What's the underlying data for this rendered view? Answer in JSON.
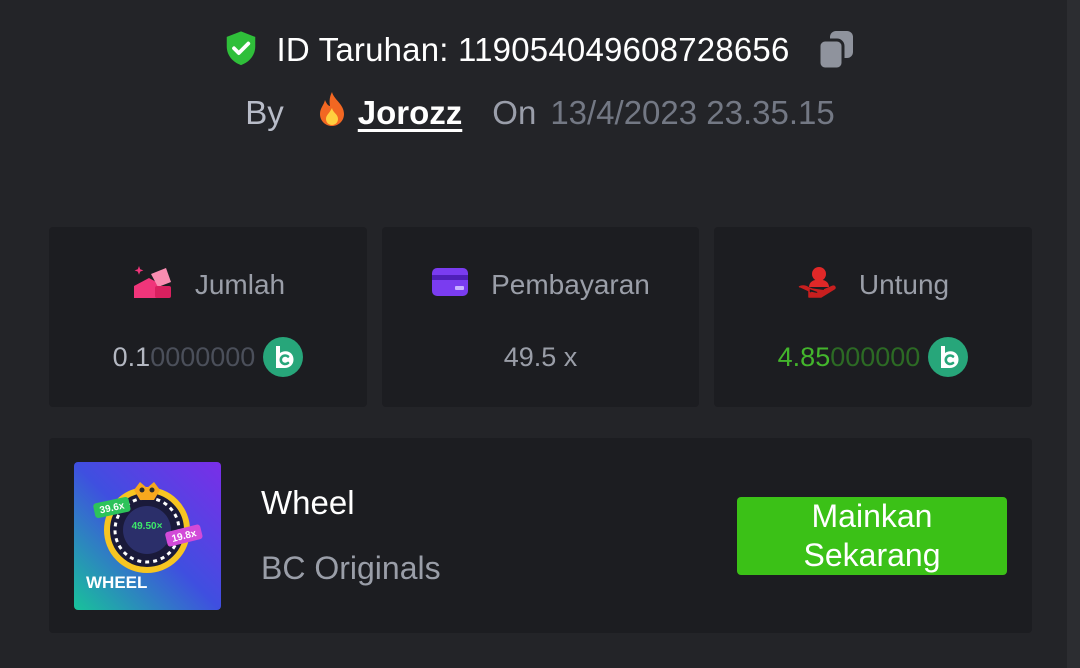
{
  "header": {
    "bet_id_text": "ID Taruhan: 119054049608728656",
    "by_label": "By",
    "username": "Jorozz",
    "on_label": "On",
    "datetime": "13/4/2023 23.35.15"
  },
  "stats": {
    "amount": {
      "label": "Jumlah",
      "value_main": "0.1",
      "value_rest": "0000000"
    },
    "payout": {
      "label": "Pembayaran",
      "value": "49.5 x"
    },
    "profit": {
      "label": "Untung",
      "value_main": "4.85",
      "value_rest": "000000"
    }
  },
  "game": {
    "name": "Wheel",
    "provider": "BC Originals",
    "play_label": "Mainkan Sekarang",
    "thumb": {
      "title": "WHEEL",
      "chip_left": "39.6x",
      "chip_center": "49.50×",
      "chip_right": "19.8x"
    }
  },
  "colors": {
    "background": "#232428",
    "card": "#1c1d21",
    "profit_green": "#43b52c",
    "play_button": "#3bc117",
    "coin": "#27a67a"
  }
}
